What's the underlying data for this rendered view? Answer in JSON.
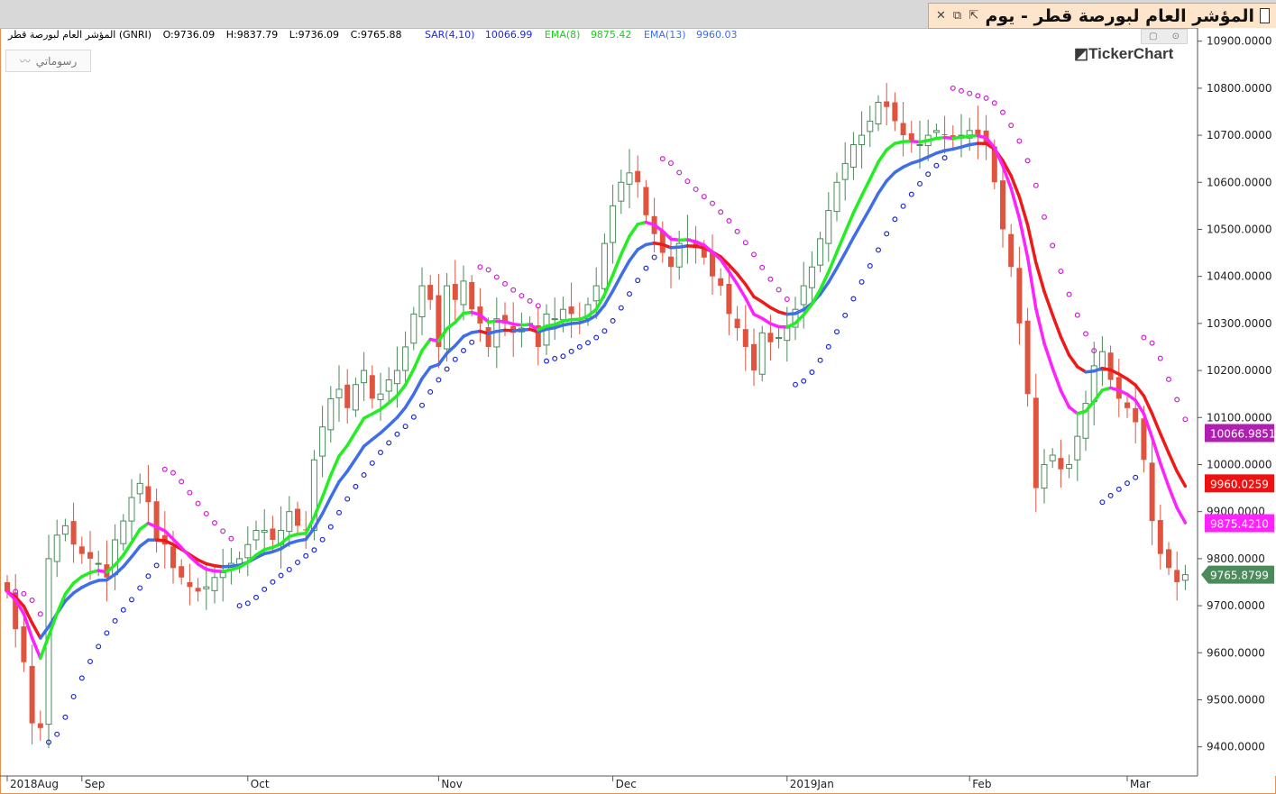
{
  "window": {
    "title": "المؤشر العام لبورصة قطر - يوم",
    "close_icon": "close-icon",
    "restore_icon": "restore-icon",
    "detach_icon": "detach-icon"
  },
  "info": {
    "symbol": "المؤشر العام لبورصة قطر (GNRI)",
    "open": "O:9736.09",
    "high": "H:9837.79",
    "low": "L:9736.09",
    "close": "C:9765.88",
    "sar_label": "SAR(4,10)",
    "sar_value": "10066.99",
    "ema8_label": "EMA(8)",
    "ema8_value": "9875.42",
    "ema13_label": "EMA(13)",
    "ema13_value": "9960.03"
  },
  "drawings_button": "رسوماتي",
  "logo": "TickerChart",
  "colors": {
    "up": "#4a8a5a",
    "down": "#e0533f",
    "ema8_up": "#22ee22",
    "ema8_down": "#ff22ff",
    "ema13_up": "#3f6ee8",
    "ema13_down": "#ee1a1a",
    "sar_below": "#1f2bd6",
    "sar_above": "#cc22cc",
    "sar_badge": "#b020b0",
    "ema13_badge": "#ee1111",
    "ema8_badge": "#ff22ff",
    "price_badge": "#4b8a5b"
  },
  "chart_data": {
    "type": "candlestick",
    "ylim": [
      9340,
      10930
    ],
    "y_ticks": [
      9400,
      9500,
      9600,
      9700,
      9800,
      9900,
      10000,
      10100,
      10200,
      10300,
      10400,
      10500,
      10600,
      10700,
      10800,
      10900
    ],
    "y_tick_labels": [
      "9400.0000",
      "9500.0000",
      "9600.0000",
      "9700.0000",
      "9800.0000",
      "9900.0000",
      "10000.0000",
      "10100.0000",
      "10200.0000",
      "10300.0000",
      "10400.0000",
      "10500.0000",
      "10600.0000",
      "10700.0000",
      "10800.0000",
      "10900.0000"
    ],
    "x_labels": [
      {
        "text": "2018Aug",
        "index": 0
      },
      {
        "text": "Sep",
        "index": 9
      },
      {
        "text": "Oct",
        "index": 29
      },
      {
        "text": "Nov",
        "index": 52
      },
      {
        "text": "Dec",
        "index": 73
      },
      {
        "text": "2019Jan",
        "index": 94
      },
      {
        "text": "Feb",
        "index": 116
      },
      {
        "text": "Mar",
        "index": 135
      }
    ],
    "badges": [
      {
        "label": "10066.9851",
        "value": 10066.99,
        "color_key": "sar_badge"
      },
      {
        "label": "9960.0259",
        "value": 9960.03,
        "color_key": "ema13_badge"
      },
      {
        "label": "9875.4210",
        "value": 9875.42,
        "color_key": "ema8_badge"
      },
      {
        "label": "9765.8799",
        "value": 9765.88,
        "color_key": "price_badge"
      }
    ],
    "last_close": 9765.88,
    "close": [
      9730,
      9650,
      9580,
      9450,
      9440,
      9800,
      9850,
      9870,
      9830,
      9810,
      9800,
      9790,
      9760,
      9840,
      9880,
      9930,
      9960,
      9920,
      9840,
      9830,
      9780,
      9760,
      9740,
      9730,
      9740,
      9760,
      9770,
      9790,
      9800,
      9830,
      9860,
      9860,
      9840,
      9860,
      9900,
      9870,
      9860,
      10010,
      10080,
      10140,
      10160,
      10120,
      10170,
      10200,
      10140,
      10150,
      10180,
      10200,
      10250,
      10320,
      10380,
      10350,
      10250,
      10380,
      10350,
      10390,
      10330,
      10300,
      10250,
      10310,
      10300,
      10280,
      10290,
      10300,
      10250,
      10320,
      10310,
      10330,
      10320,
      10310,
      10340,
      10380,
      10470,
      10550,
      10600,
      10620,
      10600,
      10530,
      10490,
      10450,
      10420,
      10470,
      10480,
      10460,
      10440,
      10400,
      10380,
      10320,
      10290,
      10250,
      10200,
      10280,
      10260,
      10270,
      10290,
      10330,
      10380,
      10420,
      10480,
      10540,
      10600,
      10640,
      10680,
      10700,
      10730,
      10770,
      10760,
      10730,
      10700,
      10690,
      10680,
      10700,
      10710,
      10700,
      10690,
      10700,
      10710,
      10700,
      10680,
      10600,
      10500,
      10420,
      10300,
      10150,
      9950,
      10000,
      10020,
      9990,
      10000,
      10060,
      10130,
      10210,
      10240,
      10180,
      10140,
      10120,
      10090,
      10010,
      9880,
      9810,
      9780,
      9750,
      9766
    ]
  }
}
